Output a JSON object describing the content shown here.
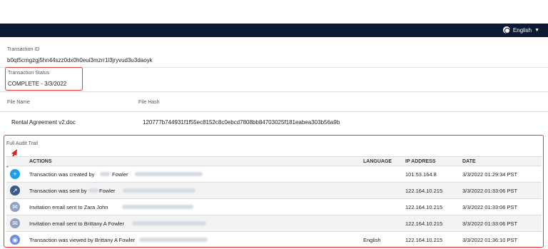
{
  "header": {
    "language_label": "English",
    "icons": {
      "language": "globe-icon",
      "menu": "caret-down-icon"
    }
  },
  "transaction": {
    "id_label": "Transaction ID",
    "id_value": "b0qt5cmgzgj5hn44szz0dx0h0eui3mzrr1l3jryvud3u3daoyk",
    "status_label": "Transaction Status",
    "status_value": "COMPLETE - 3/3/2022"
  },
  "file": {
    "name_label": "File Name",
    "hash_label": "File Hash",
    "name_value": "Rental Agreement v2.doc",
    "hash_value": "120777b744931f1f55ec8152c8c0ebcd7808bb84703025f181eabea303b56a9b"
  },
  "audit": {
    "title": "Full Audit Trail",
    "columns": [
      "ACTIONS",
      "LANGUAGE",
      "IP ADDRESS",
      "DATE"
    ],
    "rows": [
      {
        "icon": "plus-icon",
        "icon_color": "#1e9ee8",
        "action": "Transaction was created by",
        "name_suffix": "Fowler",
        "language": "",
        "ip": "101.53.164.8",
        "date": "3/3/2022 01:29:34 PST"
      },
      {
        "icon": "share-icon",
        "icon_color": "#3c5a88",
        "action": "Transaction was sent by",
        "name_suffix": "Fowler",
        "language": "",
        "ip": "122.164.10.215",
        "date": "3/3/2022 01:33:06 PST"
      },
      {
        "icon": "mail-icon",
        "icon_color": "#8ea2bf",
        "action": "Invitation email sent to Zara John",
        "name_suffix": "",
        "language": "",
        "ip": "122.164.10.215",
        "date": "3/3/2022 01:33:06 PST"
      },
      {
        "icon": "mail-icon",
        "icon_color": "#8ea2bf",
        "action": "Invitation email sent to Brittany A Fowler",
        "name_suffix": "",
        "language": "",
        "ip": "122.164.10.215",
        "date": "3/3/2022 01:33:06 PST"
      },
      {
        "icon": "eye-icon",
        "icon_color": "#6a8fe0",
        "action": "Transaction was viewed by Brittany A Fowler",
        "name_suffix": "",
        "language": "English",
        "ip": "122.164.10.215",
        "date": "3/3/2022 01:36:10 PST"
      }
    ]
  },
  "colors": {
    "topbar": "#0d1a33",
    "highlight": "#e03a3a"
  }
}
